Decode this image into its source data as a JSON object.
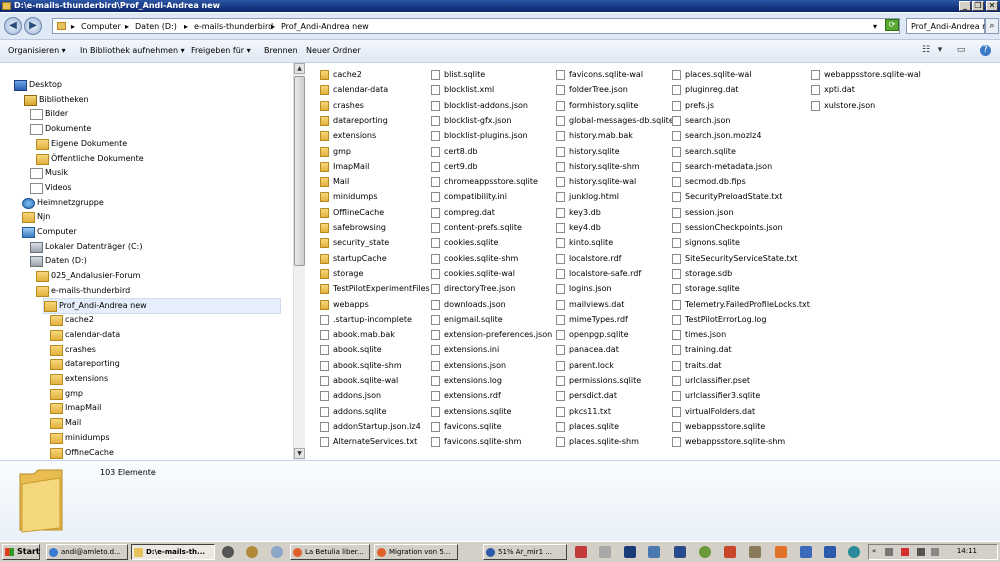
{
  "window": {
    "title": "D:\\e-mails-thunderbird\\Prof_Andi-Andrea new",
    "controls": [
      "_",
      "❐",
      "✕"
    ]
  },
  "address": {
    "crumbs": [
      "Computer",
      "Daten (D:)",
      "e-mails-thunderbird",
      "Prof_Andi-Andrea new"
    ],
    "search_placeholder": "Prof_Andi-Andrea new"
  },
  "toolbar": {
    "organize": "Organisieren",
    "include": "In Bibliothek aufnehmen",
    "share": "Freigeben für",
    "burn": "Brennen",
    "new_folder": "Neuer Ordner"
  },
  "nav": [
    {
      "label": "Desktop",
      "icon": "desk"
    },
    {
      "label": "Bibliotheken",
      "icon": "lib"
    },
    {
      "label": "Bilder",
      "icon": "doc"
    },
    {
      "label": "Dokumente",
      "icon": "doc"
    },
    {
      "label": "Eigene Dokumente",
      "icon": "folder"
    },
    {
      "label": "Öffentliche Dokumente",
      "icon": "folder"
    },
    {
      "label": "Musik",
      "icon": "doc"
    },
    {
      "label": "Videos",
      "icon": "doc"
    },
    {
      "label": "Heimnetzgruppe",
      "icon": "net"
    },
    {
      "label": "Njn",
      "icon": "folder"
    },
    {
      "label": "Computer",
      "icon": "comp"
    },
    {
      "label": "Lokaler Datenträger (C:)",
      "icon": "drive"
    },
    {
      "label": "Daten (D:)",
      "icon": "drive"
    },
    {
      "label": "025_Andalusier-Forum",
      "icon": "folder"
    },
    {
      "label": "e-mails-thunderbird",
      "icon": "folder"
    },
    {
      "label": "Prof_Andi-Andrea new",
      "icon": "folder"
    },
    {
      "label": "cache2",
      "icon": "folder"
    },
    {
      "label": "calendar-data",
      "icon": "folder"
    },
    {
      "label": "crashes",
      "icon": "folder"
    },
    {
      "label": "datareporting",
      "icon": "folder"
    },
    {
      "label": "extensions",
      "icon": "folder"
    },
    {
      "label": "gmp",
      "icon": "folder"
    },
    {
      "label": "ImapMail",
      "icon": "folder"
    },
    {
      "label": "Mail",
      "icon": "folder"
    },
    {
      "label": "minidumps",
      "icon": "folder"
    },
    {
      "label": "OffineCache",
      "icon": "folder"
    }
  ],
  "files": {
    "col1": [
      "cache2",
      "calendar-data",
      "crashes",
      "datareporting",
      "extensions",
      "gmp",
      "ImapMail",
      "Mail",
      "minidumps",
      "OfflineCache",
      "safebrowsing",
      "security_state",
      "startupCache",
      "storage",
      "TestPilotExperimentFiles",
      "webapps",
      ".startup-incomplete",
      "abook.mab.bak",
      "abook.sqlite",
      "abook.sqlite-shm",
      "abook.sqlite-wal",
      "addons.json",
      "addons.sqlite",
      "addonStartup.json.lz4",
      "AlternateServices.txt"
    ],
    "col2": [
      "blist.sqlite",
      "blocklist.xml",
      "blocklist-addons.json",
      "blocklist-gfx.json",
      "blocklist-plugins.json",
      "cert8.db",
      "cert9.db",
      "chromeappsstore.sqlite",
      "compatibility.ini",
      "compreg.dat",
      "content-prefs.sqlite",
      "cookies.sqlite",
      "cookies.sqlite-shm",
      "cookies.sqlite-wal",
      "directoryTree.json",
      "downloads.json",
      "enigmail.sqlite",
      "extension-preferences.json",
      "extensions.ini",
      "extensions.json",
      "extensions.log",
      "extensions.rdf",
      "extensions.sqlite",
      "favicons.sqlite",
      "favicons.sqlite-shm"
    ],
    "col3": [
      "favicons.sqlite-wal",
      "folderTree.json",
      "formhistory.sqlite",
      "global-messages-db.sqlite",
      "history.mab.bak",
      "history.sqlite",
      "history.sqlite-shm",
      "history.sqlite-wal",
      "junklog.html",
      "key3.db",
      "key4.db",
      "kinto.sqlite",
      "localstore.rdf",
      "localstore-safe.rdf",
      "logins.json",
      "mailviews.dat",
      "mimeTypes.rdf",
      "openpgp.sqlite",
      "panacea.dat",
      "parent.lock",
      "permissions.sqlite",
      "persdict.dat",
      "pkcs11.txt",
      "places.sqlite",
      "places.sqlite-shm"
    ],
    "col4": [
      "places.sqlite-wal",
      "pluginreg.dat",
      "prefs.js",
      "search.json",
      "search.json.mozlz4",
      "search.sqlite",
      "search-metadata.json",
      "secmod.db.fips",
      "SecurityPreloadState.txt",
      "session.json",
      "sessionCheckpoints.json",
      "signons.sqlite",
      "SiteSecurityServiceState.txt",
      "storage.sdb",
      "storage.sqlite",
      "Telemetry.FailedProfileLocks.txt",
      "TestPilotErrorLog.log",
      "times.json",
      "training.dat",
      "traits.dat",
      "urlclassifier.pset",
      "urlclassifier3.sqlite",
      "virtualFolders.dat",
      "webappsstore.sqlite",
      "webappsstore.sqlite-shm"
    ],
    "col5": [
      "webappsstore.sqlite-wal",
      "xpti.dat",
      "xulstore.json"
    ]
  },
  "details": {
    "count": "103 Elemente"
  },
  "taskbar": {
    "start": "Start",
    "tasks": [
      "andi@amleto.d...",
      "D:\\e-mails-th...",
      "La Betulia liber...",
      "Migration von 5...",
      "51% Ar_mir1 ..."
    ],
    "clock": "14:11"
  }
}
